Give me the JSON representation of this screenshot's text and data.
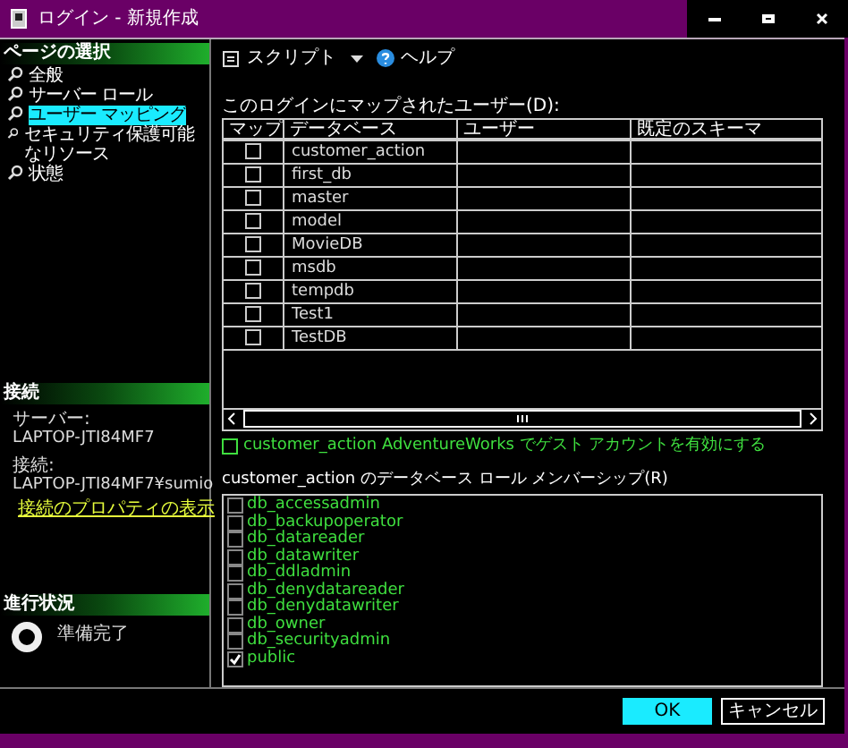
{
  "window": {
    "title": "ログイン - 新規作成"
  },
  "sidebar": {
    "title": "ページの選択",
    "items": [
      {
        "label": "全般",
        "selected": false
      },
      {
        "label": "サーバー ロール",
        "selected": false
      },
      {
        "label": "ユーザー マッピング",
        "selected": true
      },
      {
        "label": "セキュリティ保護可能なリソース",
        "selected": false
      },
      {
        "label": "状態",
        "selected": false
      }
    ]
  },
  "connection": {
    "title": "接続",
    "server_label": "サーバー:",
    "server": "LAPTOP-JTI84MF7",
    "connection_label": "接続:",
    "connection": "LAPTOP-JTI84MF7¥sumio",
    "link": "接続のプロパティの表示"
  },
  "progress": {
    "title": "進行状況",
    "status": "準備完了"
  },
  "toolbar": {
    "script": "スクリプト",
    "help": "ヘルプ"
  },
  "users": {
    "label": "このログインにマップされたユーザー(D):",
    "columns": [
      "マップ",
      "データベース",
      "ユーザー",
      "既定のスキーマ"
    ],
    "rows": [
      {
        "database": "customer_action",
        "checked": false
      },
      {
        "database": "first_db",
        "checked": false
      },
      {
        "database": "master",
        "checked": false
      },
      {
        "database": "model",
        "checked": false
      },
      {
        "database": "MovieDB",
        "checked": false
      },
      {
        "database": "msdb",
        "checked": false
      },
      {
        "database": "tempdb",
        "checked": false
      },
      {
        "database": "Test1",
        "checked": false
      },
      {
        "database": "TestDB",
        "checked": false
      }
    ]
  },
  "guest": {
    "label": "customer_action AdventureWorks でゲスト アカウントを有効にする",
    "checked": false
  },
  "roles": {
    "label": "customer_action のデータベース ロール メンバーシップ(R)",
    "items": [
      {
        "name": "db_accessadmin",
        "checked": false
      },
      {
        "name": "db_backupoperator",
        "checked": false
      },
      {
        "name": "db_datareader",
        "checked": false
      },
      {
        "name": "db_datawriter",
        "checked": false
      },
      {
        "name": "db_ddladmin",
        "checked": false
      },
      {
        "name": "db_denydatareader",
        "checked": false
      },
      {
        "name": "db_denydatawriter",
        "checked": false
      },
      {
        "name": "db_owner",
        "checked": false
      },
      {
        "name": "db_securityadmin",
        "checked": false
      },
      {
        "name": "public",
        "checked": true
      }
    ]
  },
  "buttons": {
    "ok": "OK",
    "cancel": "キャンセル"
  }
}
